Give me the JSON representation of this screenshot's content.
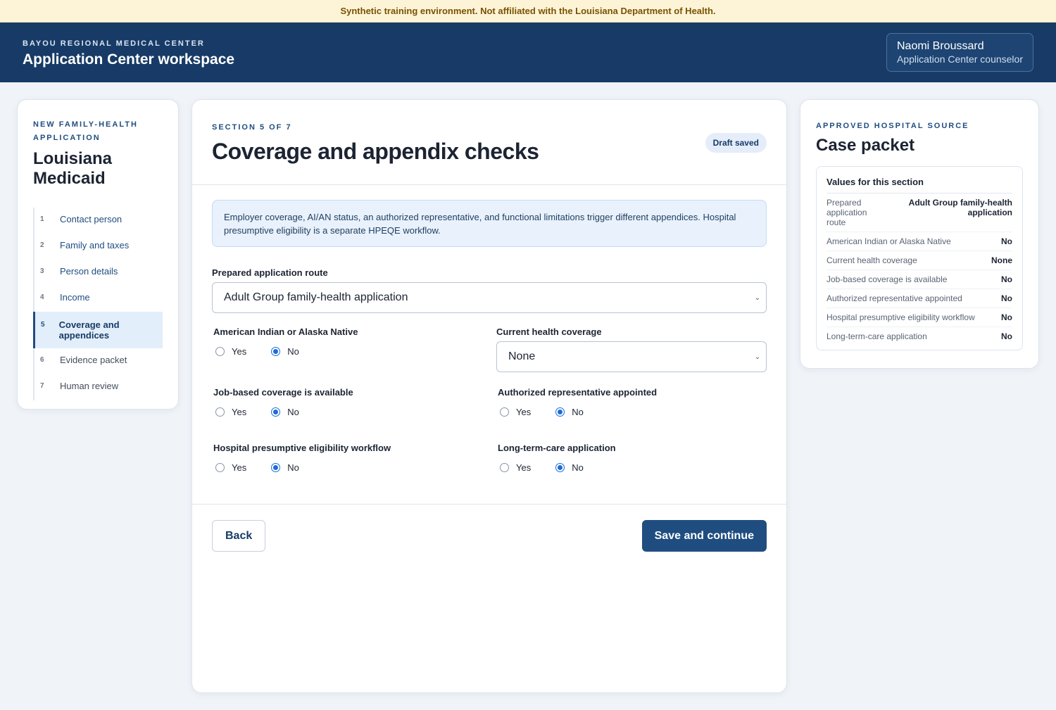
{
  "banner": "Synthetic training environment. Not affiliated with the Louisiana Department of Health.",
  "header": {
    "org": "BAYOU REGIONAL MEDICAL CENTER",
    "title": "Application Center workspace",
    "user_name": "Naomi Broussard",
    "user_role": "Application Center counselor"
  },
  "sidebar": {
    "eyebrow": "NEW FAMILY-HEALTH APPLICATION",
    "title": "Louisiana Medicaid",
    "steps": [
      {
        "num": "1",
        "label": "Contact person"
      },
      {
        "num": "2",
        "label": "Family and taxes"
      },
      {
        "num": "3",
        "label": "Person details"
      },
      {
        "num": "4",
        "label": "Income"
      },
      {
        "num": "5",
        "label": "Coverage and appendices"
      },
      {
        "num": "6",
        "label": "Evidence packet"
      },
      {
        "num": "7",
        "label": "Human review"
      }
    ]
  },
  "main": {
    "section": "SECTION 5 OF 7",
    "title": "Coverage and appendix checks",
    "badge": "Draft saved",
    "notice": "Employer coverage, AI/AN status, an authorized representative, and functional limitations trigger different appendices. Hospital presumptive eligibility is a separate HPEQE workflow.",
    "route_label": "Prepared application route",
    "route_value": "Adult Group family-health application",
    "yes_label": "Yes",
    "no_label": "No",
    "q_aian": "American Indian or Alaska Native",
    "q_coverage": "Current health coverage",
    "coverage_value": "None",
    "q_job": "Job-based coverage is available",
    "q_rep": "Authorized representative appointed",
    "q_hpe": "Hospital presumptive eligibility workflow",
    "q_ltc": "Long-term-care application",
    "back": "Back",
    "save": "Save and continue"
  },
  "packet": {
    "eyebrow": "APPROVED HOSPITAL SOURCE",
    "title": "Case packet",
    "head": "Values for this section",
    "rows": [
      {
        "k": "Prepared application route",
        "v": "Adult Group family-health application"
      },
      {
        "k": "American Indian or Alaska Native",
        "v": "No"
      },
      {
        "k": "Current health coverage",
        "v": "None"
      },
      {
        "k": "Job-based coverage is available",
        "v": "No"
      },
      {
        "k": "Authorized representative appointed",
        "v": "No"
      },
      {
        "k": "Hospital presumptive eligibility workflow",
        "v": "No"
      },
      {
        "k": "Long-term-care application",
        "v": "No"
      }
    ]
  }
}
